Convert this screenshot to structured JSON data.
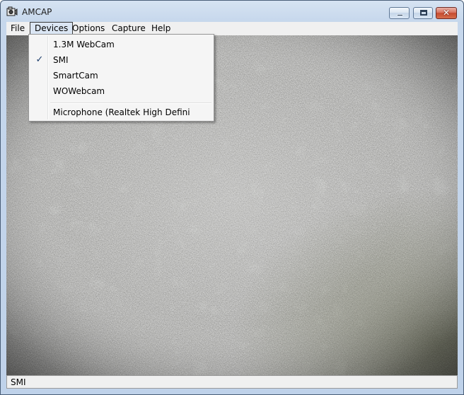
{
  "window": {
    "title": "AMCAP",
    "icon": "camera-app-icon",
    "controls": {
      "minimize": "minimize-icon",
      "maximize": "maximize-icon",
      "close_glyph": "✕"
    }
  },
  "menubar": {
    "items": [
      {
        "label": "File",
        "open": false
      },
      {
        "label": "Devices",
        "open": true
      },
      {
        "label": "Options",
        "open": false
      },
      {
        "label": "Capture",
        "open": false
      },
      {
        "label": "Help",
        "open": false
      }
    ]
  },
  "devices_menu": {
    "video_devices": [
      {
        "label": "1.3M WebCam",
        "checked": false
      },
      {
        "label": "SMI",
        "checked": true
      },
      {
        "label": "SmartCam",
        "checked": false
      },
      {
        "label": "WOWebcam",
        "checked": false
      }
    ],
    "audio_devices": [
      {
        "label": "Microphone (Realtek High Defini",
        "checked": false
      }
    ],
    "check_glyph": "✓"
  },
  "video_preview": {
    "description_icon": "camera-preview"
  },
  "statusbar": {
    "text": "SMI"
  },
  "colors": {
    "frame": "#c6d7ec",
    "menu_bg": "#f0f0f0",
    "close_button": "#c54a2f",
    "open_menu_highlight": "#dbe6f4",
    "preview_texture": "#6e6d6a"
  }
}
